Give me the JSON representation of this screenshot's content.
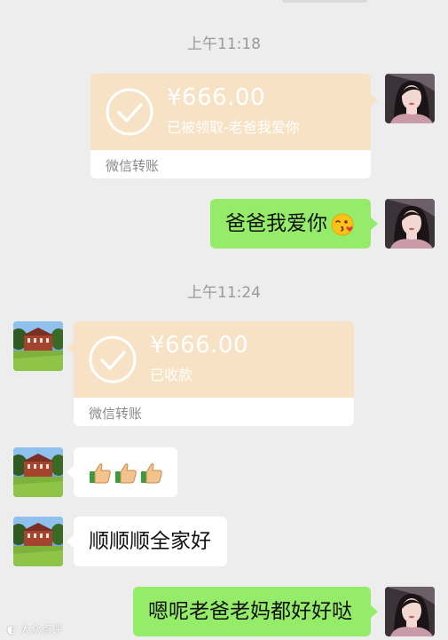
{
  "timestamps": [
    "上午11:18",
    "上午11:24"
  ],
  "messages": {
    "transfer_sent": {
      "amount": "¥666.00",
      "status": "已被领取-老爸我爱你",
      "footer": "微信转账"
    },
    "text_me_1": {
      "text": "爸爸我爱你",
      "emoji": "kissing-face-icon"
    },
    "transfer_received": {
      "amount": "¥666.00",
      "status": "已收款",
      "footer": "微信转账"
    },
    "thumbs": {
      "emoji": "thumbs-up-icon",
      "count": 3
    },
    "text_other_1": {
      "text": "顺顺顺全家好"
    },
    "text_me_2": {
      "text": "嗯呢老爸老妈都好好哒"
    }
  },
  "watermark": "大众点评",
  "colors": {
    "background": "#ededed",
    "bubble_me": "#95ec69",
    "bubble_other": "#ffffff",
    "transfer_top": "#f8e2c5",
    "time_text": "#9a9a9a"
  }
}
